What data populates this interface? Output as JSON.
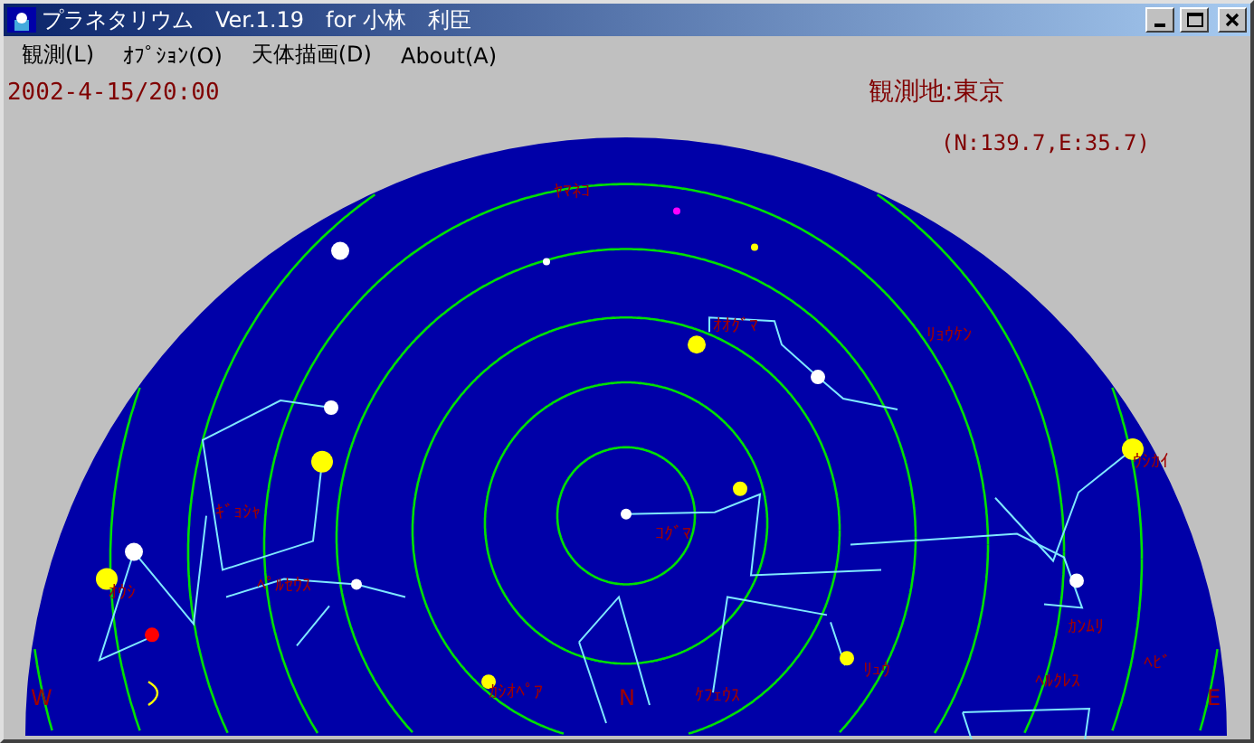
{
  "window": {
    "title": "プラネタリウム　Ver.1.19　for 小林　利臣"
  },
  "menu": [
    {
      "label": "観測(L)"
    },
    {
      "label": "ｵﾌﾟｼｮﾝ(O)"
    },
    {
      "label": "天体描画(D)"
    },
    {
      "label": "About(A)"
    }
  ],
  "observation": {
    "datetime": "2002-4-15/20:00",
    "location": "観測地:東京",
    "coordinates": "(N:139.7,E:35.7)"
  },
  "sky": {
    "constellations": [
      "ﾔﾏﾈｺ",
      "ｵｵｸﾞﾏ",
      "ﾘｮｳｹﾝ",
      "ｳｼｶｲ",
      "ｷﾞｮｼｬ",
      "ｺｸﾞﾏ",
      "ﾍﾟﾙｾｳｽ",
      "ｵｳｼ",
      "ｶﾝﾑﾘ",
      "ﾍﾋﾞ",
      "ﾘｭｳ",
      "ﾍﾙｸﾚｽ",
      "ｶｼｵﾍﾟｱ",
      "ｹﾌｪｳｽ"
    ],
    "directions": [
      "W",
      "N",
      "E"
    ]
  }
}
